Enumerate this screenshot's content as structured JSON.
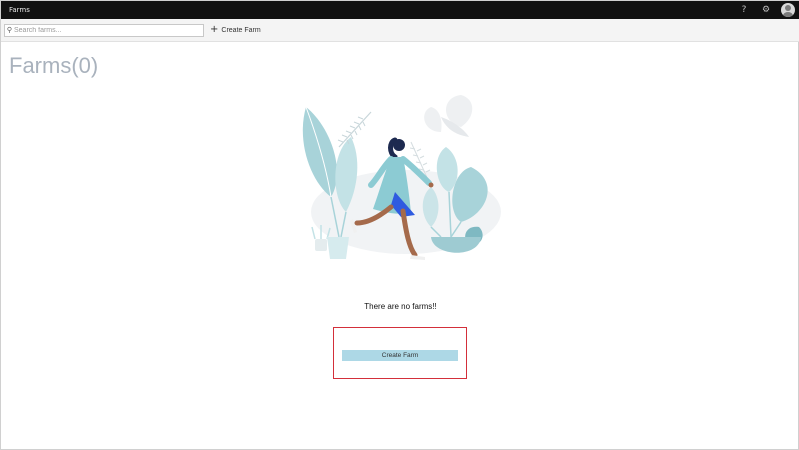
{
  "app": {
    "title": "Farms"
  },
  "header": {
    "help_icon": "?",
    "settings_icon": "⚙",
    "avatar": "user-avatar"
  },
  "toolbar": {
    "search_placeholder": "Search farms...",
    "search_value": "",
    "create_label": "Create Farm",
    "create_icon": "+"
  },
  "main": {
    "title": "Farms(0)",
    "empty_message": "There are no farms!!",
    "create_button_label": "Create Farm",
    "illustration": "person-walking-among-plants"
  },
  "colors": {
    "topbar": "#111111",
    "title_text": "#a9b2bd",
    "button_bg": "#add8e6",
    "highlight_border": "#d32f3a",
    "plant": "#a8d3d9",
    "plant_dark": "#7fb9c2"
  }
}
